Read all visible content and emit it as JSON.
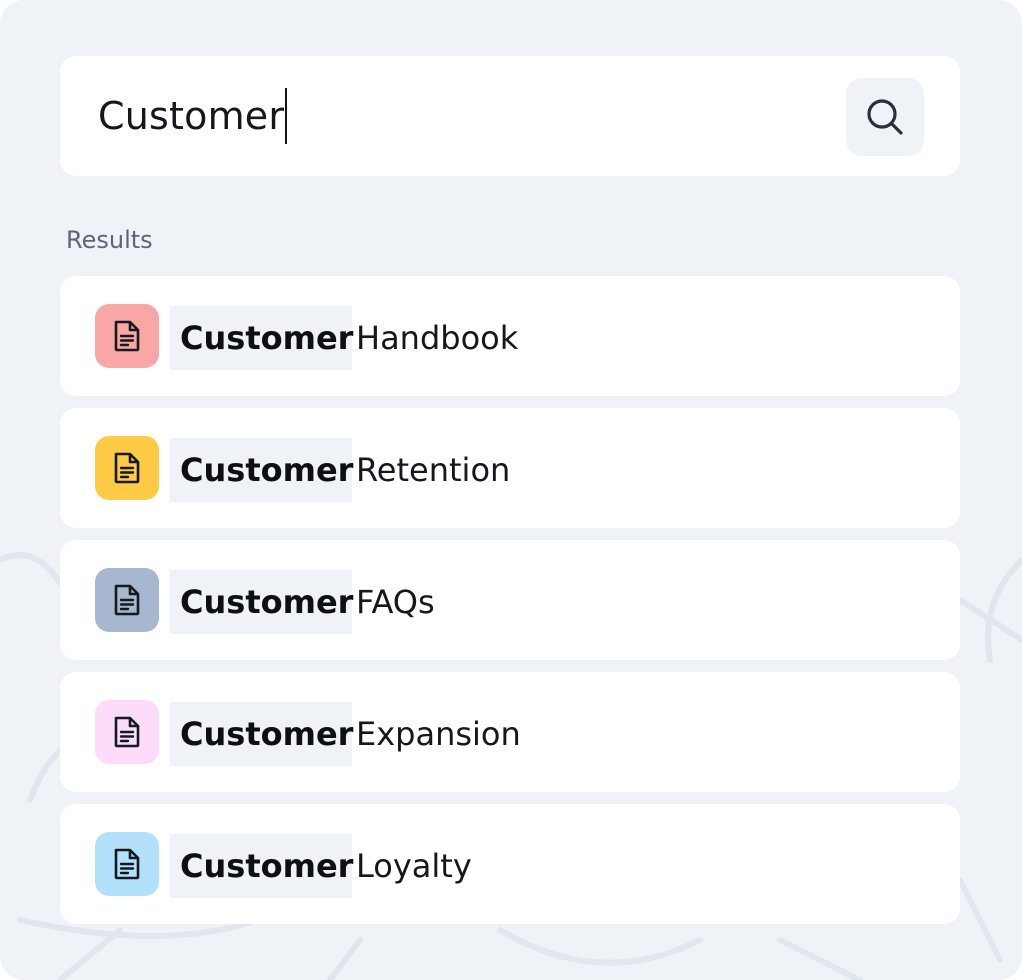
{
  "search": {
    "value": "Customer",
    "button_icon": "search-icon"
  },
  "results_heading": "Results",
  "results": [
    {
      "match": "Customer",
      "rest": "Handbook",
      "icon": "document-icon",
      "tile_color": "#f9a6a6"
    },
    {
      "match": "Customer",
      "rest": "Retention",
      "icon": "document-icon",
      "tile_color": "#ffcb47"
    },
    {
      "match": "Customer",
      "rest": "FAQs",
      "icon": "document-icon",
      "tile_color": "#a6b7cf"
    },
    {
      "match": "Customer",
      "rest": "Expansion",
      "icon": "document-icon",
      "tile_color": "#fddcfb"
    },
    {
      "match": "Customer",
      "rest": "Loyalty",
      "icon": "document-icon",
      "tile_color": "#b3e1fa"
    }
  ],
  "colors": {
    "panel_bg": "#eff2f7",
    "card_bg": "#ffffff",
    "highlight_bg": "#eff2f7"
  }
}
